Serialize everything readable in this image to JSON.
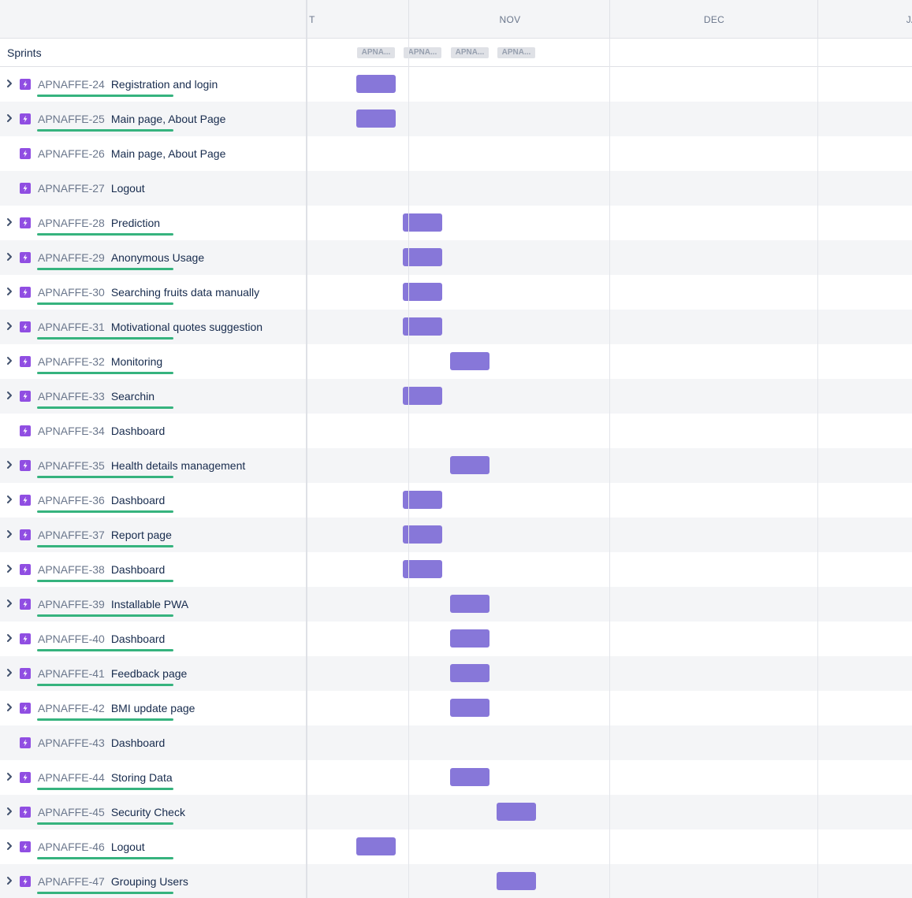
{
  "timeline": {
    "months": [
      "T",
      "NOV",
      "DEC",
      "JA"
    ],
    "sprints_label": "Sprints",
    "sprint_chips": [
      "APNA...",
      "APNA...",
      "APNA...",
      "APNA..."
    ]
  },
  "colors": {
    "epic_icon": "#904ee2",
    "progress_bar": "#36b37e",
    "timeline_bar": "#8777d9"
  },
  "epics": [
    {
      "key": "APNAFFE-24",
      "summary": "Registration and login",
      "has_children": true,
      "sprint": 1
    },
    {
      "key": "APNAFFE-25",
      "summary": "Main page, About Page",
      "has_children": true,
      "sprint": 1
    },
    {
      "key": "APNAFFE-26",
      "summary": "Main page, About Page",
      "has_children": false,
      "sprint": 0
    },
    {
      "key": "APNAFFE-27",
      "summary": "Logout",
      "has_children": false,
      "sprint": 0
    },
    {
      "key": "APNAFFE-28",
      "summary": "Prediction",
      "has_children": true,
      "sprint": 2
    },
    {
      "key": "APNAFFE-29",
      "summary": "Anonymous Usage",
      "has_children": true,
      "sprint": 2
    },
    {
      "key": "APNAFFE-30",
      "summary": "Searching fruits data manually",
      "has_children": true,
      "sprint": 2
    },
    {
      "key": "APNAFFE-31",
      "summary": "Motivational quotes suggestion",
      "has_children": true,
      "sprint": 2
    },
    {
      "key": "APNAFFE-32",
      "summary": "Monitoring",
      "has_children": true,
      "sprint": 3
    },
    {
      "key": "APNAFFE-33",
      "summary": "Searchin",
      "has_children": true,
      "sprint": 2
    },
    {
      "key": "APNAFFE-34",
      "summary": "Dashboard",
      "has_children": false,
      "sprint": 0
    },
    {
      "key": "APNAFFE-35",
      "summary": "Health details management",
      "has_children": true,
      "sprint": 3
    },
    {
      "key": "APNAFFE-36",
      "summary": "Dashboard",
      "has_children": true,
      "sprint": 2
    },
    {
      "key": "APNAFFE-37",
      "summary": "Report page",
      "has_children": true,
      "sprint": 2
    },
    {
      "key": "APNAFFE-38",
      "summary": "Dashboard",
      "has_children": true,
      "sprint": 2
    },
    {
      "key": "APNAFFE-39",
      "summary": "Installable PWA",
      "has_children": true,
      "sprint": 3
    },
    {
      "key": "APNAFFE-40",
      "summary": "Dashboard",
      "has_children": true,
      "sprint": 3
    },
    {
      "key": "APNAFFE-41",
      "summary": "Feedback page",
      "has_children": true,
      "sprint": 3
    },
    {
      "key": "APNAFFE-42",
      "summary": "BMI update page",
      "has_children": true,
      "sprint": 3
    },
    {
      "key": "APNAFFE-43",
      "summary": "Dashboard",
      "has_children": false,
      "sprint": 0
    },
    {
      "key": "APNAFFE-44",
      "summary": "Storing Data",
      "has_children": true,
      "sprint": 3
    },
    {
      "key": "APNAFFE-45",
      "summary": "Security Check",
      "has_children": true,
      "sprint": 4
    },
    {
      "key": "APNAFFE-46",
      "summary": "Logout",
      "has_children": true,
      "sprint": 1
    },
    {
      "key": "APNAFFE-47",
      "summary": "Grouping Users",
      "has_children": true,
      "sprint": 4
    }
  ]
}
